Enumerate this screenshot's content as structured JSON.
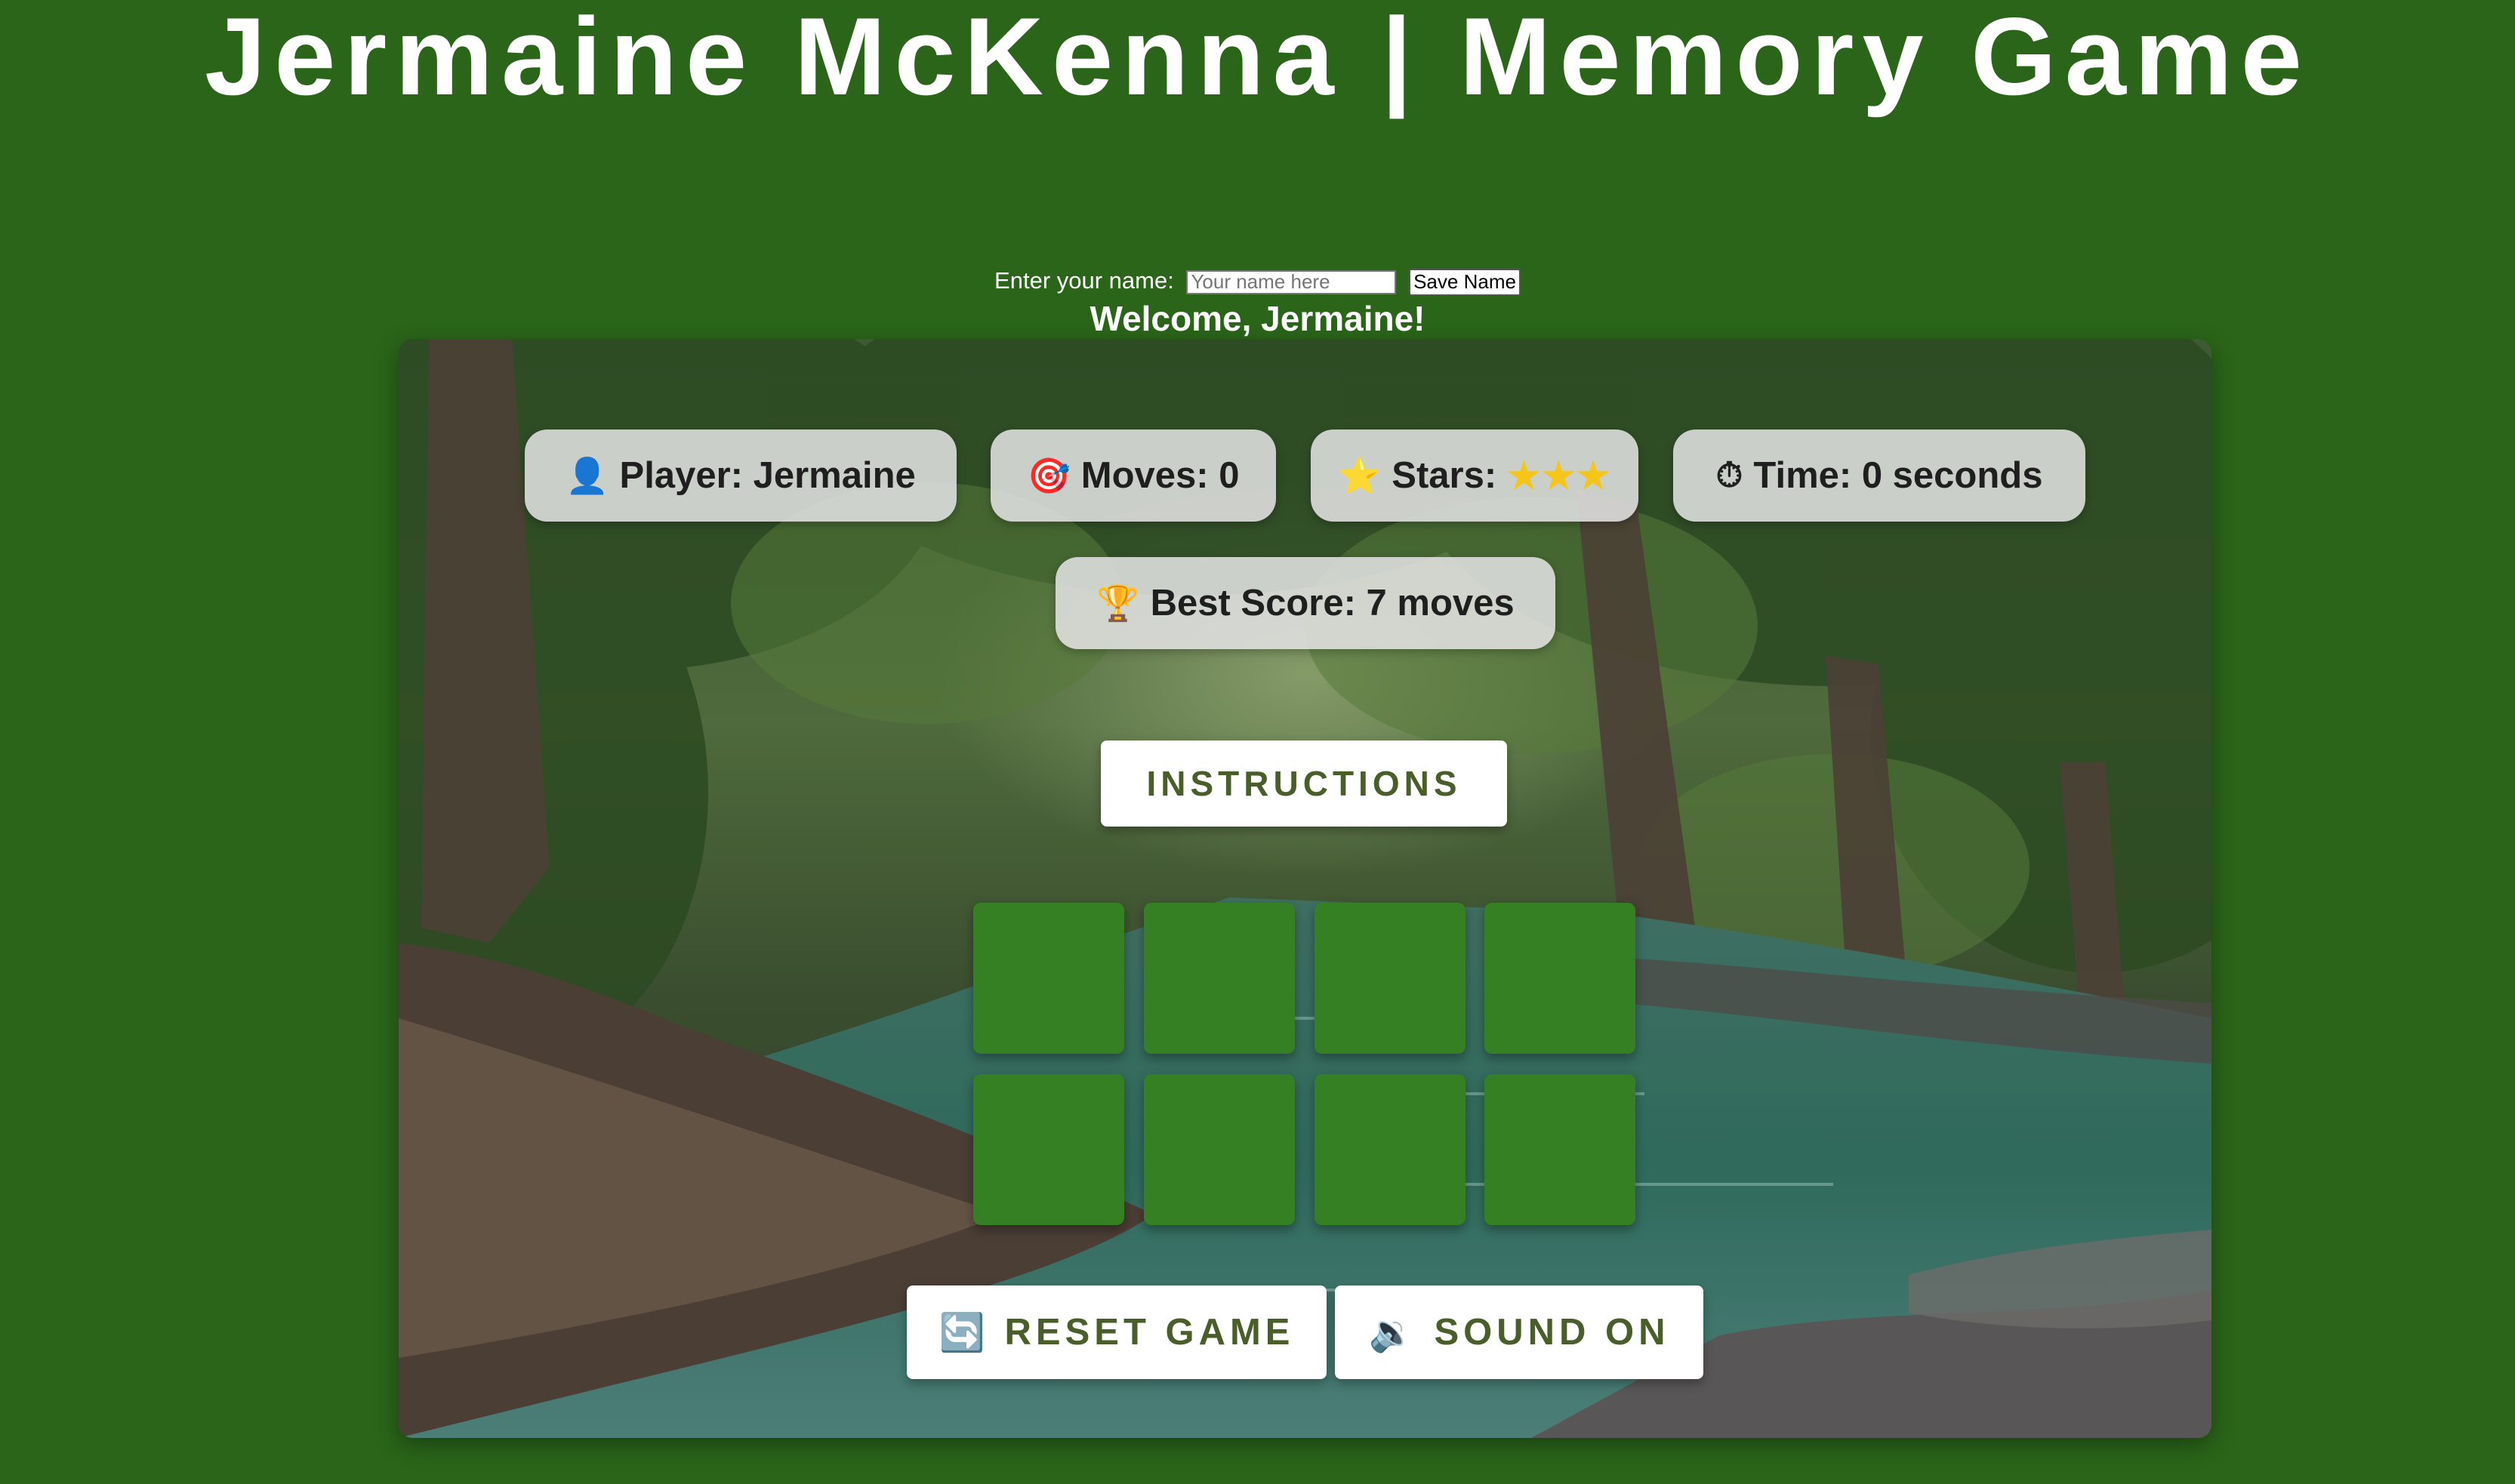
{
  "title": "Jermaine McKenna | Memory Game",
  "name_form": {
    "label": "Enter your name:",
    "input_value": "",
    "placeholder": "Your name here",
    "save_label": "Save Name"
  },
  "welcome": "Welcome, Jermaine!",
  "stats": {
    "player": {
      "icon": "👤",
      "icon_name": "person-icon",
      "label": "Player: Jermaine"
    },
    "moves": {
      "icon": "🎯",
      "icon_name": "target-icon",
      "label": "Moves: 0"
    },
    "stars": {
      "icon": "⭐",
      "icon_name": "star-icon",
      "label": "Stars:",
      "value": "★★★",
      "count": 3
    },
    "time": {
      "icon": "⏱",
      "icon_name": "stopwatch-icon",
      "label": "Time: 0 seconds"
    },
    "best": {
      "icon": "🏆",
      "icon_name": "trophy-icon",
      "label": "Best Score: 7 moves"
    }
  },
  "instructions_label": "INSTRUCTIONS",
  "cards": {
    "count": 8,
    "face_down_color": "#348022"
  },
  "controls": {
    "reset": {
      "icon": "🔄",
      "icon_name": "refresh-icon",
      "label": "RESET GAME"
    },
    "sound": {
      "icon": "🔉",
      "icon_name": "speaker-icon",
      "label": "SOUND ON"
    }
  },
  "colors": {
    "page_background": "#2a6519",
    "button_text": "#4a5e2a",
    "stat_pill": "#e1e1e1"
  }
}
